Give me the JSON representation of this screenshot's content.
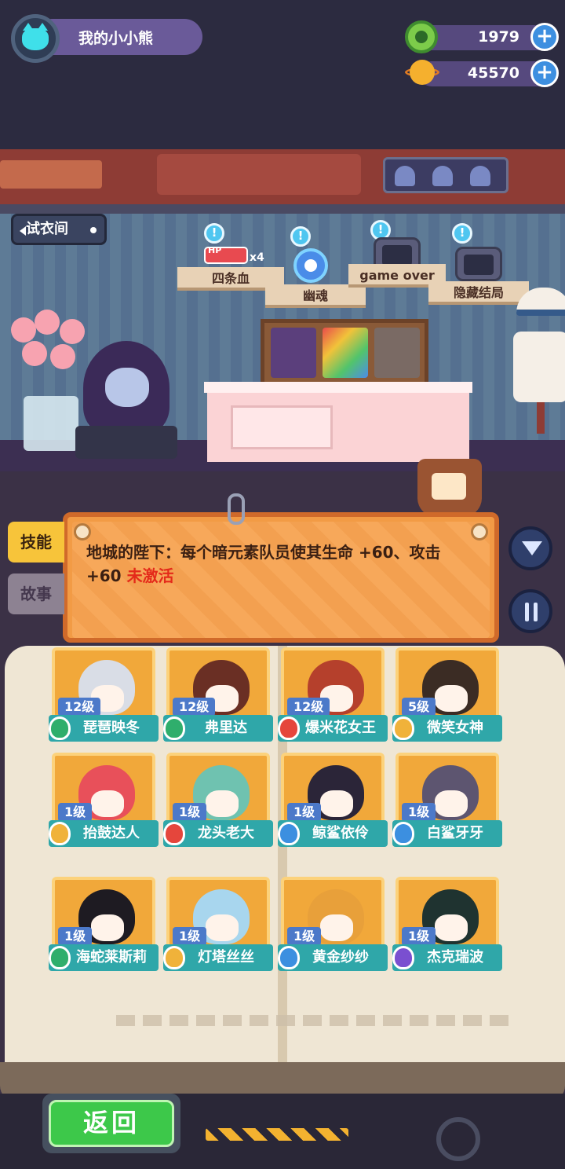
{
  "profile": {
    "name": "我的小小熊",
    "avatar_icon": "cat-icon"
  },
  "currencies": [
    {
      "icon": "green-coin-icon",
      "amount": "1979",
      "add_label": "+"
    },
    {
      "icon": "planet-coin-icon",
      "amount": "45570",
      "add_label": "+"
    }
  ],
  "room": {
    "fitting_room_label": "试衣间",
    "exhibits": [
      {
        "label": "四条血",
        "icon": "hp-battery-icon",
        "hp_text": "HP",
        "multiplier": "x4",
        "alert": "!"
      },
      {
        "label": "幽魂",
        "icon": "skull-icon",
        "alert": "!"
      },
      {
        "label": "game over",
        "icon": "tombstone-tv-icon",
        "alert": "!"
      },
      {
        "label": "隐藏结局",
        "icon": "screen-tv-icon",
        "alert": "!"
      }
    ]
  },
  "side_tabs": {
    "skill": "技能",
    "story": "故事"
  },
  "skill_panel": {
    "description": "地城的陛下：每个暗元素队员使其生命 +60、攻击 +60 ",
    "status": "未激活"
  },
  "characters": [
    {
      "level": "12级",
      "name": "琵琶映冬",
      "badge_color": "#2fae6c",
      "hair": "#d9dde6"
    },
    {
      "level": "12级",
      "name": "弗里达",
      "badge_color": "#2fae6c",
      "hair": "#6a2f24"
    },
    {
      "level": "12级",
      "name": "爆米花女王",
      "badge_color": "#e5463c",
      "hair": "#b5402c"
    },
    {
      "level": "5级",
      "name": "微笑女神",
      "badge_color": "#f0b23a",
      "hair": "#3b2c24"
    },
    {
      "level": "1级",
      "name": "抬鼓达人",
      "badge_color": "#f0b23a",
      "hair": "#e8505a"
    },
    {
      "level": "1级",
      "name": "龙头老大",
      "badge_color": "#e5463c",
      "hair": "#6fc2b0"
    },
    {
      "level": "1级",
      "name": "鲸鲨依伶",
      "badge_color": "#3c8fe0",
      "hair": "#2b2538"
    },
    {
      "level": "1级",
      "name": "白鲨牙牙",
      "badge_color": "#3c8fe0",
      "hair": "#5d5570"
    },
    {
      "level": "1级",
      "name": "海蛇莱斯莉",
      "badge_color": "#2fae6c",
      "hair": "#1e1b22"
    },
    {
      "level": "1级",
      "name": "灯塔丝丝",
      "badge_color": "#f0b23a",
      "hair": "#a8d6ee"
    },
    {
      "level": "1级",
      "name": "黄金纱纱",
      "badge_color": "#3c8fe0",
      "hair": "#e8a03a"
    },
    {
      "level": "1级",
      "name": "杰克瑞波",
      "badge_color": "#7a4fd0",
      "hair": "#1f3330"
    }
  ],
  "bottom": {
    "back_label": "返回"
  }
}
